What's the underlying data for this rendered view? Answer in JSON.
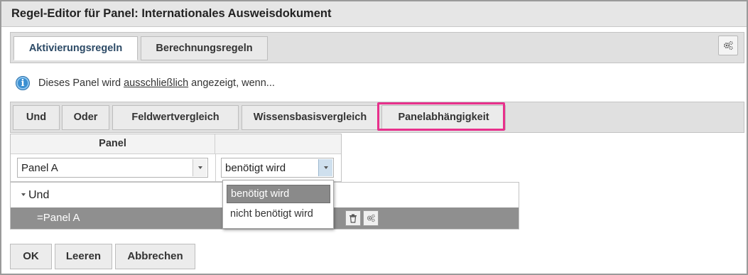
{
  "window": {
    "title": "Regel-Editor für Panel: Internationales Ausweisdokument"
  },
  "tabs": [
    {
      "label": "Aktivierungsregeln",
      "active": true
    },
    {
      "label": "Berechnungsregeln",
      "active": false
    }
  ],
  "settings_icon": "gears-icon",
  "info": {
    "icon": "info-icon",
    "text_before": "Dieses Panel wird ",
    "text_underlined": "ausschließlich",
    "text_after": " angezeigt, wenn..."
  },
  "toolbar": {
    "buttons": [
      "Und",
      "Oder",
      "Feldwertvergleich",
      "Wissensbasisvergleich",
      "Panelabhängigkeit"
    ],
    "highlighted": "Panelabhängigkeit",
    "highlight_color": "#e8308c"
  },
  "grid": {
    "header_panel": "Panel",
    "header_state": "",
    "panel_value": "Panel A",
    "state_value": "benötigt wird"
  },
  "dropdown": {
    "options": [
      "benötigt wird",
      "nicht benötigt wird"
    ],
    "selected": "benötigt wird"
  },
  "tree": {
    "root_label": "Und",
    "child_label": "=Panel A"
  },
  "footer": {
    "ok_label": "OK",
    "clear_label": "Leeren",
    "cancel_label": "Abbrechen"
  },
  "colors": {
    "active_tab_text": "#2c4a66",
    "selected_row_bg": "#8f8f8f",
    "info_blue": "#3a8fd1"
  }
}
